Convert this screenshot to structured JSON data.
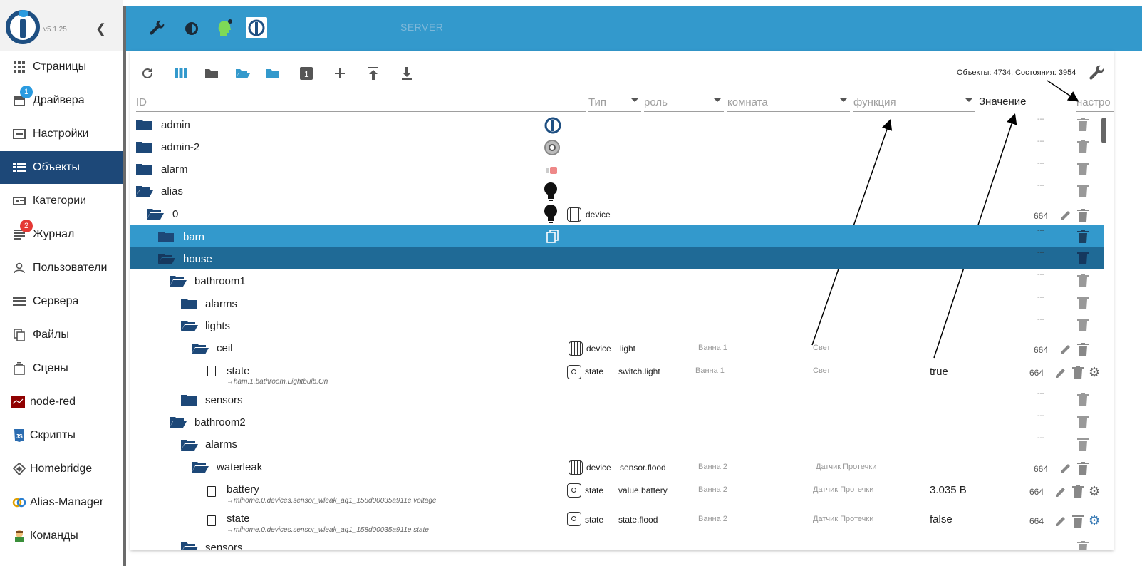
{
  "app": {
    "version": "v5.1.25"
  },
  "sidebar": {
    "items": [
      {
        "label": "Страницы",
        "icon": "grid-icon"
      },
      {
        "label": "Драйвера",
        "icon": "store-icon",
        "badge": "1"
      },
      {
        "label": "Настройки",
        "icon": "settings-panel-icon"
      },
      {
        "label": "Объекты",
        "icon": "list-icon"
      },
      {
        "label": "Категории",
        "icon": "category-icon"
      },
      {
        "label": "Журнал",
        "icon": "log-icon",
        "badge": "2"
      },
      {
        "label": "Пользователи",
        "icon": "user-icon"
      },
      {
        "label": "Сервера",
        "icon": "server-icon"
      },
      {
        "label": "Файлы",
        "icon": "files-icon"
      },
      {
        "label": "Сцены",
        "icon": "scenes-icon"
      },
      {
        "label": "node-red",
        "icon": "node-red-icon"
      },
      {
        "label": "Скрипты",
        "icon": "js-icon"
      },
      {
        "label": "Homebridge",
        "icon": "homebridge-icon"
      },
      {
        "label": "Alias-Manager",
        "icon": "alias-manager-icon"
      },
      {
        "label": "Команды",
        "icon": "commands-icon"
      }
    ]
  },
  "header": {
    "server_label": "SERVER"
  },
  "toolbar": {
    "stats": "Объекты: 4734, Состояния: 3954"
  },
  "filters": {
    "id": "ID",
    "type": "Тип",
    "role": "роль",
    "room": "комната",
    "function": "функция",
    "value": "Значение",
    "settings": "настро"
  },
  "rows": [
    {
      "name": "admin",
      "acl": "---"
    },
    {
      "name": "admin-2",
      "acl": "---"
    },
    {
      "name": "alarm",
      "acl": "---"
    },
    {
      "name": "alias",
      "acl": "---"
    },
    {
      "name": "0",
      "type": "device",
      "acl": "664"
    },
    {
      "name": "barn",
      "acl": "---"
    },
    {
      "name": "house",
      "acl": "---"
    },
    {
      "name": "bathroom1",
      "acl": "---"
    },
    {
      "name": "alarms",
      "acl": "---"
    },
    {
      "name": "lights",
      "acl": "---"
    },
    {
      "name": "ceil",
      "type": "device",
      "role": "light",
      "room": "Ванна 1",
      "function": "Свет",
      "acl": "664"
    },
    {
      "name": "state",
      "alias": "→ham.1.bathroom.Lightbulb.On",
      "type": "state",
      "role": "switch.light",
      "room": "Ванна 1",
      "function": "Свет",
      "value": "true",
      "acl": "664"
    },
    {
      "name": "sensors",
      "acl": "---"
    },
    {
      "name": "bathroom2",
      "acl": "---"
    },
    {
      "name": "alarms",
      "acl": "---"
    },
    {
      "name": "waterleak",
      "type": "device",
      "role": "sensor.flood",
      "room": "Ванна 2",
      "function": "Датчик Протечки",
      "acl": "664"
    },
    {
      "name": "battery",
      "alias": "→mihome.0.devices.sensor_wleak_aq1_158d00035a911e.voltage",
      "type": "state",
      "role": "value.battery",
      "room": "Ванна 2",
      "function": "Датчик Протечки",
      "value": "3.035 В",
      "acl": "664"
    },
    {
      "name": "state",
      "alias": "→mihome.0.devices.sensor_wleak_aq1_158d00035a911e.state",
      "type": "state",
      "role": "state.flood",
      "room": "Ванна 2",
      "function": "Датчик Протечки",
      "value": "false",
      "acl": "664"
    },
    {
      "name": "sensors",
      "acl": "---"
    }
  ],
  "colors": {
    "header": "#3399cc",
    "sidebar_active": "#1d4878",
    "row_selected": "#3399cc",
    "row_selected_dark": "#1f6a96",
    "folder": "#1d4878"
  }
}
